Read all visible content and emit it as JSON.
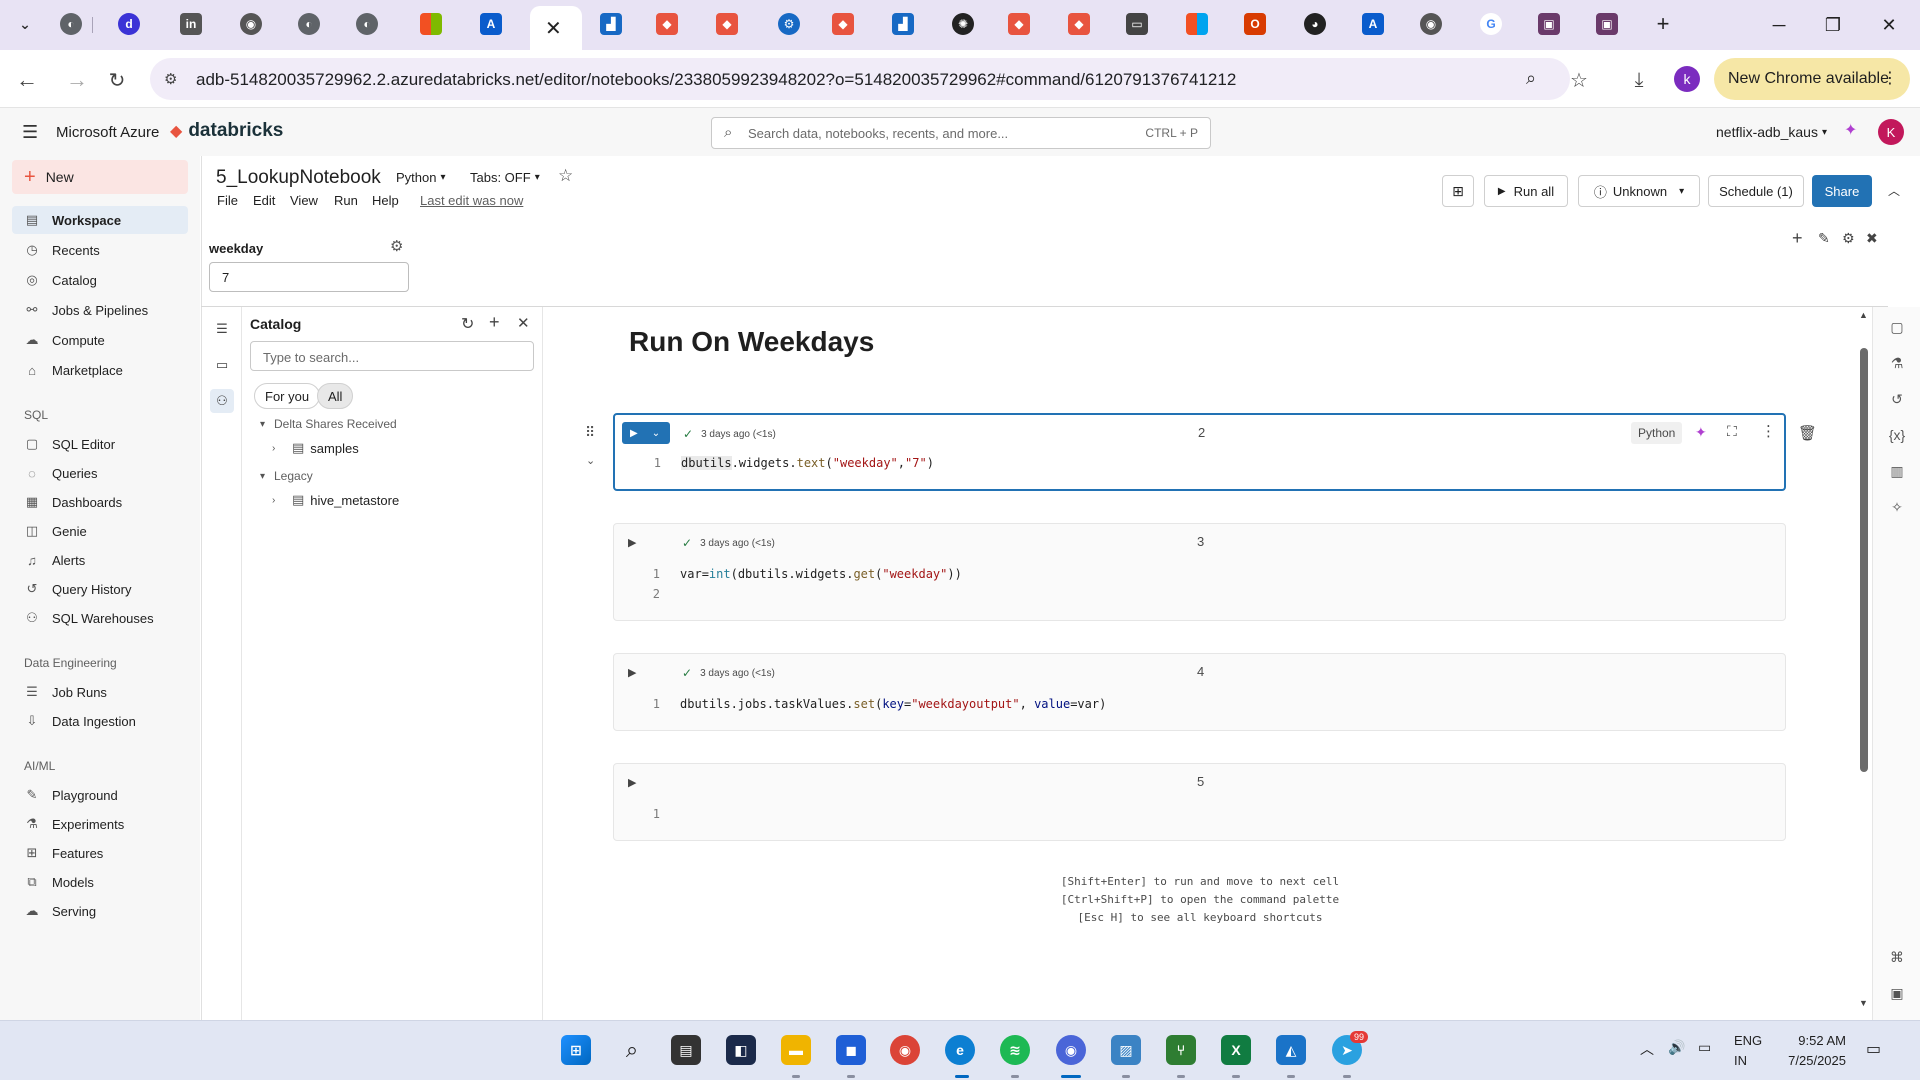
{
  "browser": {
    "url": "adb-514820035729962.2.azuredatabricks.net/editor/notebooks/2338059923948202?o=514820035729962#command/6120791376741212",
    "update_button": "New Chrome available",
    "profile_initial": "k"
  },
  "databricks": {
    "brand": "Microsoft Azure",
    "logo_text": "databricks",
    "search_placeholder": "Search data, notebooks, recents, and more...",
    "search_shortcut": "CTRL + P",
    "workspace_name": "netflix-adb_kaus",
    "user_initial": "K"
  },
  "nav": {
    "new": "New",
    "items": [
      "Workspace",
      "Recents",
      "Catalog",
      "Jobs & Pipelines",
      "Compute",
      "Marketplace"
    ],
    "sql_section": "SQL",
    "sql_items": [
      "SQL Editor",
      "Queries",
      "Dashboards",
      "Genie",
      "Alerts",
      "Query History",
      "SQL Warehouses"
    ],
    "de_section": "Data Engineering",
    "de_items": [
      "Job Runs",
      "Data Ingestion"
    ],
    "ml_section": "AI/ML",
    "ml_items": [
      "Playground",
      "Experiments",
      "Features",
      "Models",
      "Serving"
    ]
  },
  "notebook": {
    "title": "5_LookupNotebook",
    "language": "Python",
    "tabs": "Tabs: OFF",
    "menu": [
      "File",
      "Edit",
      "View",
      "Run",
      "Help"
    ],
    "last_edit": "Last edit was now",
    "run_all": "Run all",
    "compute": "Unknown",
    "schedule": "Schedule (1)",
    "share": "Share",
    "widget_label": "weekday",
    "widget_value": "7",
    "heading": "Run On Weekdays"
  },
  "catalog": {
    "title": "Catalog",
    "search_placeholder": "Type to search...",
    "filter_for_you": "For you",
    "filter_all": "All",
    "group_delta": "Delta Shares Received",
    "item_samples": "samples",
    "group_legacy": "Legacy",
    "item_hive": "hive_metastore"
  },
  "cells": [
    {
      "num": "2",
      "status": "3 days ago (<1s)",
      "lang_badge": "Python",
      "lines": [
        {
          "n": "1"
        }
      ]
    },
    {
      "num": "3",
      "status": "3 days ago (<1s)",
      "lines": [
        {
          "n": "1"
        },
        {
          "n": "2"
        }
      ]
    },
    {
      "num": "4",
      "status": "3 days ago (<1s)",
      "lines": [
        {
          "n": "1"
        }
      ]
    },
    {
      "num": "5",
      "lines": [
        {
          "n": "1"
        }
      ]
    }
  ],
  "hints": [
    "[Shift+Enter] to run and move to next cell",
    "[Ctrl+Shift+P] to open the command palette",
    "[Esc H] to see all keyboard shortcuts"
  ],
  "taskbar": {
    "lang_line1": "ENG",
    "lang_line2": "IN",
    "time": "9:52 AM",
    "date": "7/25/2025",
    "badge": "99"
  },
  "colors": {
    "accent": "#2272b4",
    "new_button_bg": "#fbe5e3",
    "chrome_update_bg": "#f6e7a6"
  }
}
